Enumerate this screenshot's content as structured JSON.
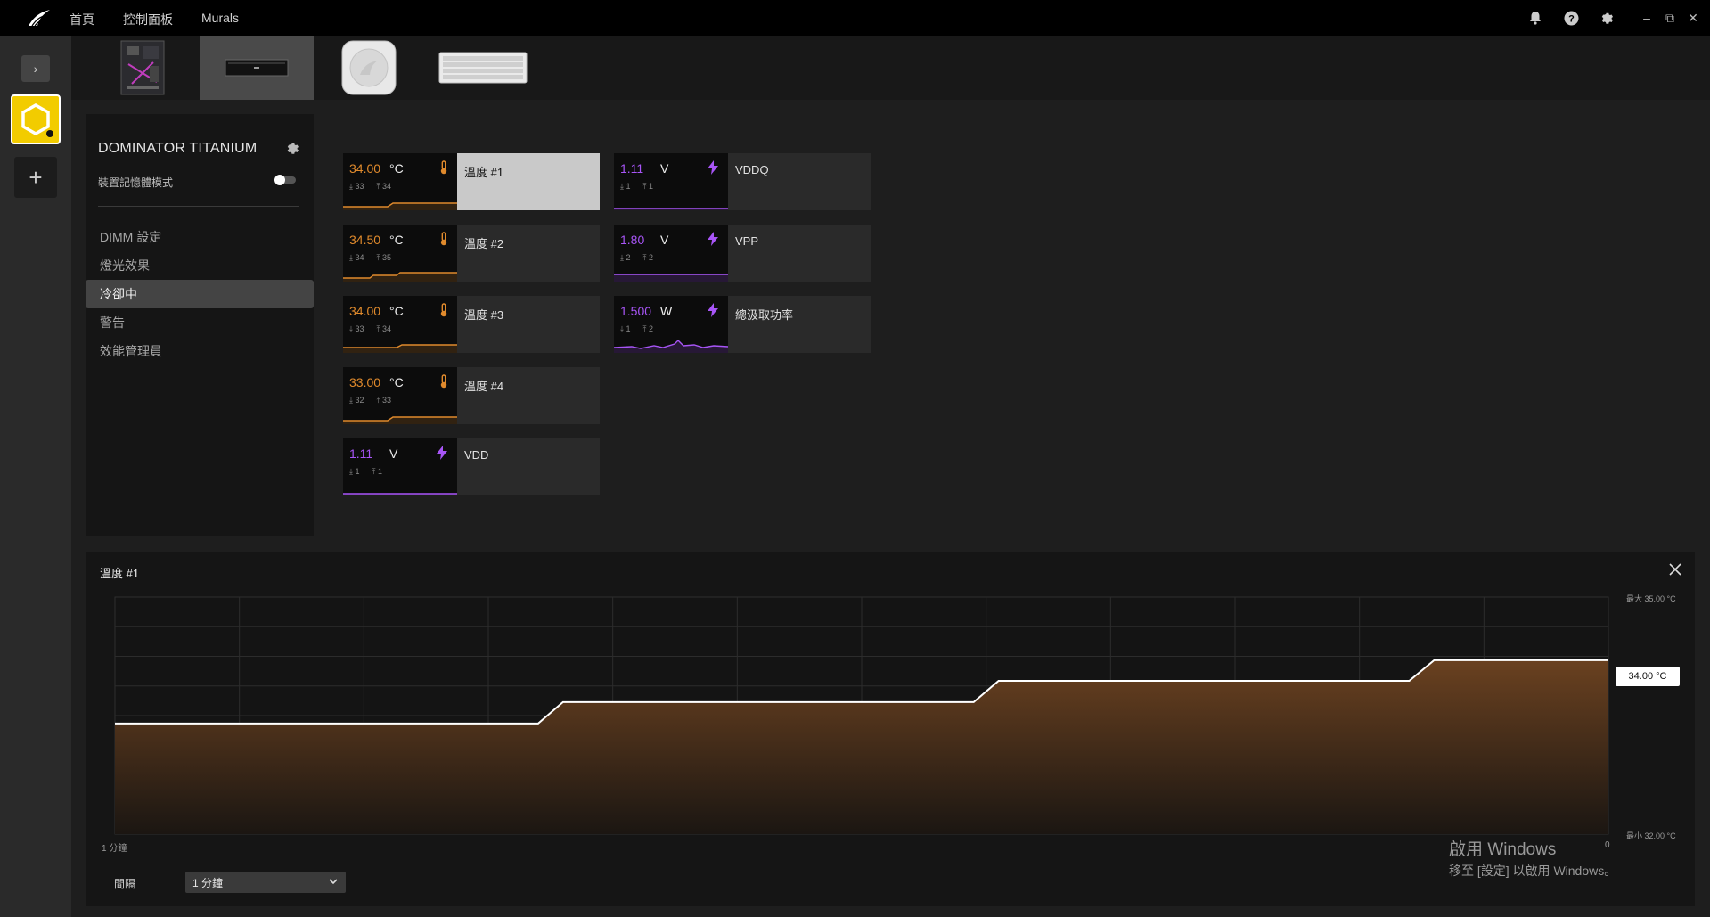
{
  "topnav": {
    "home": "首頁",
    "dashboard": "控制面板",
    "murals": "Murals"
  },
  "window_controls": {
    "minimize": "–",
    "restore": "⧉",
    "close": "✕"
  },
  "rail": {
    "expand": "›",
    "add": "+"
  },
  "device_strip": {
    "items": [
      {
        "name": "motherboard"
      },
      {
        "name": "dominator-memory",
        "selected": true
      },
      {
        "name": "aio-pump-cooler"
      },
      {
        "name": "keyboard"
      }
    ]
  },
  "sidebar": {
    "device_name": "DOMINATOR TITANIUM",
    "memory_mode_label": "裝置記憶體模式",
    "menu": [
      {
        "label": "DIMM 設定",
        "active": false
      },
      {
        "label": "燈光效果",
        "active": false
      },
      {
        "label": "冷卻中",
        "active": true
      },
      {
        "label": "警告",
        "active": false
      },
      {
        "label": "效能管理員",
        "active": false
      }
    ]
  },
  "sensors": [
    {
      "id": "t1",
      "value": "34.00",
      "unit": "°C",
      "min": "33",
      "max": "34",
      "label": "溫度 #1",
      "kind": "temp",
      "selected": true
    },
    {
      "id": "t2",
      "value": "34.50",
      "unit": "°C",
      "min": "34",
      "max": "35",
      "label": "溫度 #2",
      "kind": "temp",
      "selected": false
    },
    {
      "id": "t3",
      "value": "34.00",
      "unit": "°C",
      "min": "33",
      "max": "34",
      "label": "溫度 #3",
      "kind": "temp",
      "selected": false
    },
    {
      "id": "t4",
      "value": "33.00",
      "unit": "°C",
      "min": "32",
      "max": "33",
      "label": "溫度 #4",
      "kind": "temp",
      "selected": false
    },
    {
      "id": "vdd",
      "value": "1.11",
      "unit": "V",
      "min": "1",
      "max": "1",
      "label": "VDD",
      "kind": "power",
      "selected": false
    },
    {
      "id": "vddq",
      "value": "1.11",
      "unit": "V",
      "min": "1",
      "max": "1",
      "label": "VDDQ",
      "kind": "power",
      "selected": false
    },
    {
      "id": "vpp",
      "value": "1.80",
      "unit": "V",
      "min": "2",
      "max": "2",
      "label": "VPP",
      "kind": "power",
      "selected": false
    },
    {
      "id": "watt",
      "value": "1.500",
      "unit": "W",
      "min": "1",
      "max": "2",
      "label": "總汲取功率",
      "kind": "power",
      "selected": false
    }
  ],
  "colors": {
    "temp": "#e08a2c",
    "power": "#a855f7",
    "accent_yellow": "#f2cc00",
    "chart_fill_top": "#6a4120",
    "chart_fill_bottom": "#1b1612"
  },
  "chart": {
    "title": "溫度 #1",
    "x_left_label": "1 分鐘",
    "x_right_label": "0",
    "y_max_label": "最大 35.00 °C",
    "y_min_label": "最小 32.00 °C",
    "current_label": "34.00 °C",
    "interval_label": "間隔",
    "interval_value": "1 分鐘"
  },
  "chart_data": {
    "type": "area",
    "title": "溫度 #1",
    "xlabel": "",
    "ylabel": "",
    "x": [
      -60,
      -25.5,
      -23.5,
      -5.5,
      -3.5,
      0
    ],
    "x_range_seconds": [
      -60,
      0
    ],
    "ylim": [
      32,
      35
    ],
    "series": [
      {
        "points": [
          [
            -60,
            33.4
          ],
          [
            -43,
            33.4
          ],
          [
            -42,
            33.67
          ],
          [
            -25.5,
            33.67
          ],
          [
            -24.5,
            33.94
          ],
          [
            -8,
            33.94
          ],
          [
            -7,
            34.2
          ],
          [
            0,
            34.2
          ]
        ]
      }
    ],
    "current_value": 34.0,
    "grid": true
  },
  "watermark": {
    "line1": "啟用 Windows",
    "line2": "移至 [設定] 以啟用 Windows。"
  }
}
